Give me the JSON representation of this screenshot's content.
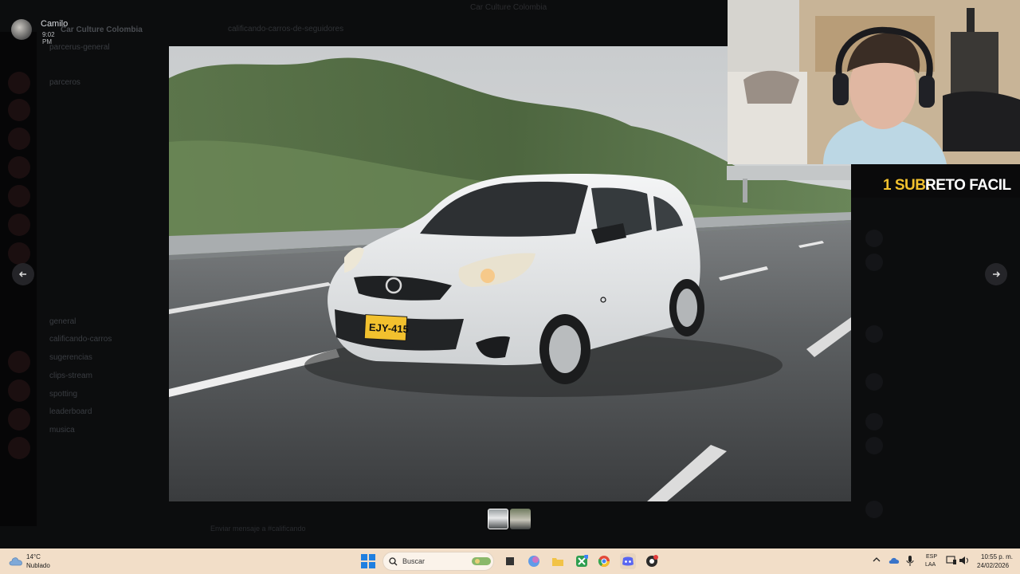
{
  "window": {
    "title": "Car Culture Colombia"
  },
  "message_author": {
    "name": "Camilo",
    "time": "9:02 PM"
  },
  "discord_background": {
    "server_name": "Car Culture Colombia",
    "channel_header": "calificando-carros-de-seguidores",
    "channels": [
      "parcerus-general",
      "parceros",
      "general",
      "calificando-carros",
      "sugerencias",
      "clips-stream",
      "spotting",
      "leaderboard",
      "musica"
    ],
    "composer_text": "Enviar mensaje a #calificando"
  },
  "viewer": {
    "image_label": "Nissan March blanco en autopista",
    "license_plate": "EJY-415",
    "thumbnails": 2,
    "prev_icon": "arrow-left-icon",
    "next_icon": "arrow-right-icon"
  },
  "stream_overlay": {
    "sub_count": "1 SUB:",
    "sub_goal": "RETO FACIL",
    "accent": "#f2c12e"
  },
  "taskbar": {
    "weather_temp": "14°C",
    "weather_condition": "Nublado",
    "search_placeholder": "Buscar",
    "lang_top": "ESP",
    "lang_bottom": "LAA",
    "time": "10:55 p. m.",
    "date": "24/02/2026",
    "apps": [
      "file-explorer-icon",
      "widgets-icon",
      "copilot-icon",
      "folder-icon",
      "xbox-icon",
      "chrome-icon",
      "discord-icon",
      "obs-icon"
    ]
  }
}
